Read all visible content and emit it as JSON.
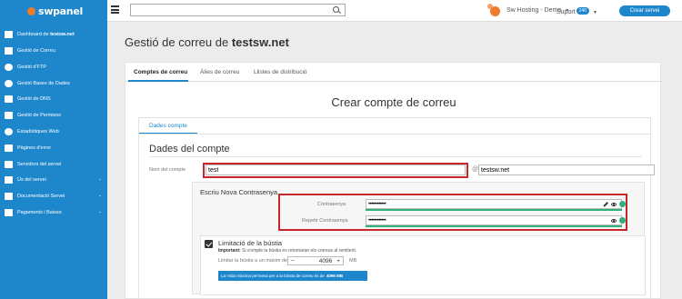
{
  "brand": {
    "logo_text": "swpanel"
  },
  "header": {
    "search_value": "",
    "company_label": "Sw Hosting - Demo",
    "support_label": "Suport",
    "support_badge": "240",
    "create_service_label": "Crear servei"
  },
  "sidebar": {
    "items": [
      {
        "label": "Dashboard de",
        "bold": "testsw.net",
        "icon": "dashboard-icon"
      },
      {
        "label": "Gestió de Correu",
        "icon": "envelope-icon"
      },
      {
        "label": "Gestió d'FTP",
        "icon": "database-icon"
      },
      {
        "label": "Gestió Bases de Dades",
        "icon": "database-icon"
      },
      {
        "label": "Gestió de DNS",
        "icon": "flag-icon"
      },
      {
        "label": "Gestió de Permisos",
        "icon": "permissions-icon"
      },
      {
        "label": "Estadístiques Web",
        "icon": "chart-icon"
      },
      {
        "label": "Pàgines d'error",
        "icon": "monitor-icon"
      },
      {
        "label": "Servidors del servei",
        "icon": "server-icon"
      },
      {
        "label": "Ús del servei",
        "icon": "usage-icon",
        "has_chevron": true
      },
      {
        "label": "Documentació Servei",
        "icon": "document-icon",
        "has_chevron": true
      },
      {
        "label": "Pagaments i Baixes",
        "icon": "payments-icon",
        "has_chevron": true
      }
    ],
    "chevron": "⌄"
  },
  "page": {
    "title_prefix": "Gestió de correu de",
    "title_domain": "testsw.net"
  },
  "tabs": [
    {
      "label": "Comptes de correu",
      "active": true
    },
    {
      "label": "Àlies de correu",
      "active": false
    },
    {
      "label": "Llistes de distribució",
      "active": false
    }
  ],
  "form": {
    "title": "Crear compte de correu",
    "subtab": "Dades compte",
    "section_title": "Dades del compte",
    "account_name_label": "Nom del compte",
    "account_name_value": "test",
    "at_sign": "@",
    "domain_value": "testsw.net",
    "password_section_title": "Escriu Nova Contrasenya",
    "password_label": "Contrasenya",
    "password_value": "••••••••••••",
    "repeat_password_label": "Repetir Contrasenya",
    "repeat_password_value": "••••••••••••",
    "limit_title": "Limitació de la bústia",
    "limit_note_bold": "Important:",
    "limit_note": "Si s'omple la bústia es retornaran els correus al remitent.",
    "limit_label": "Limitar la bústia a un màxim de",
    "limit_minus": "−",
    "limit_value": "4096",
    "limit_plus": "+",
    "limit_unit": "MB",
    "info_text": "La mida màxima permesa per a la bústia de correu és de",
    "info_bold": "4096 MB",
    "limit_checked": true
  },
  "colors": {
    "brand_blue": "#1e87cc",
    "orange": "#f07b2a",
    "highlight_red": "#c9252c",
    "green": "#2db37a"
  }
}
